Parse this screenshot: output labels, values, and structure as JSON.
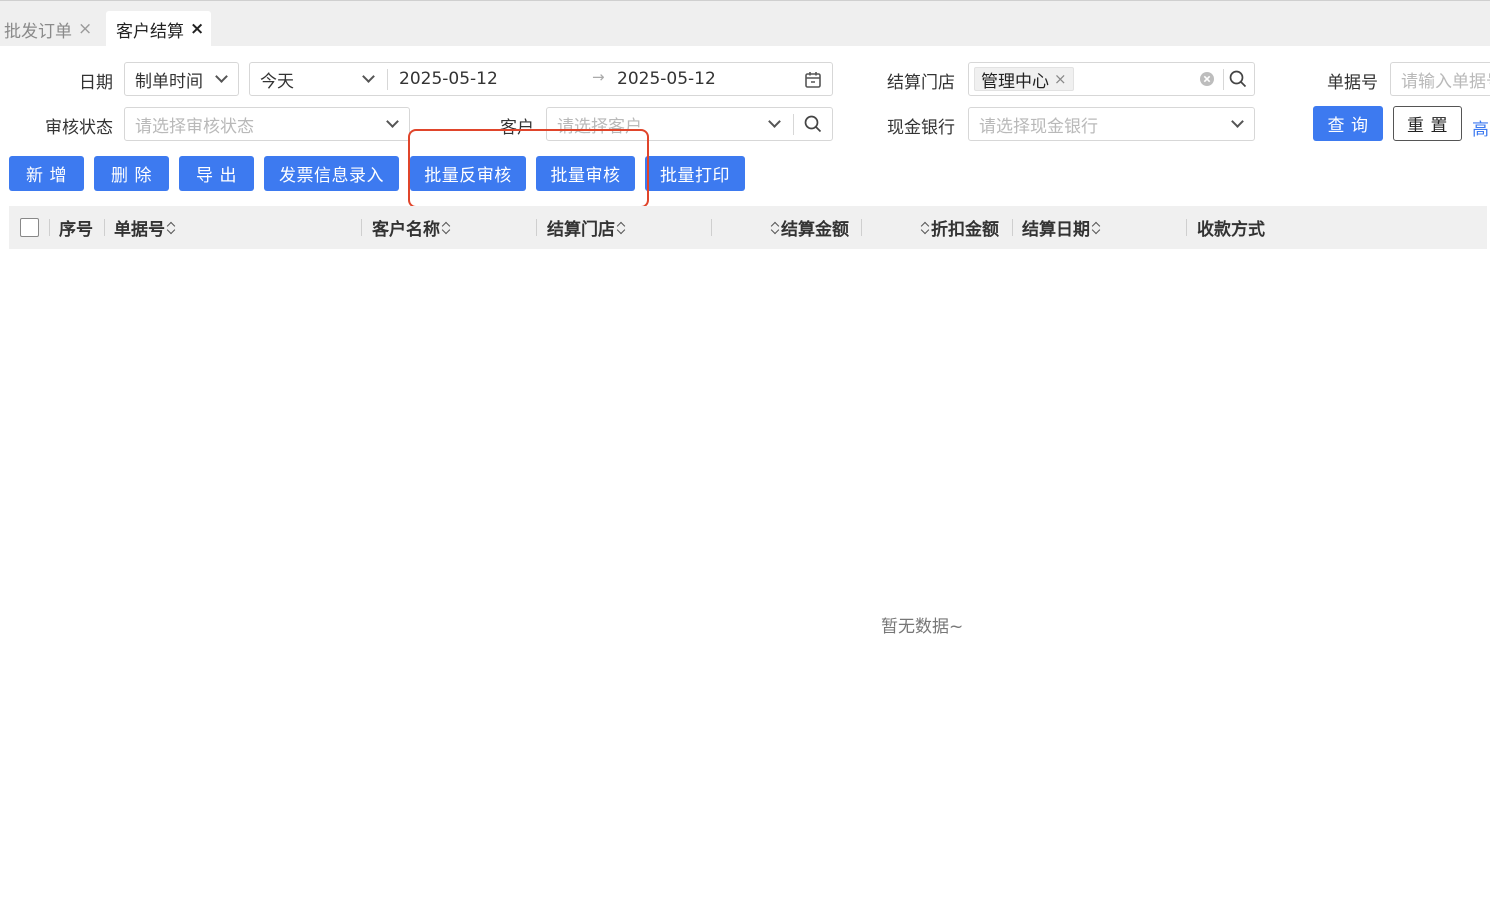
{
  "tabs": [
    {
      "label": "批发订单",
      "close": "×"
    },
    {
      "label": "客户结算",
      "close": "×"
    }
  ],
  "filters": {
    "date_label": "日期",
    "date_type": "制单时间",
    "date_range_preset": "今天",
    "date_start": "2025-05-12",
    "date_arrow": "→",
    "date_end": "2025-05-12",
    "store_label": "结算门店",
    "store_tag": "管理中心",
    "store_tag_close": "×",
    "doc_no_label": "单据号",
    "doc_no_placeholder": "请输入单据号",
    "audit_label": "审核状态",
    "audit_placeholder": "请选择审核状态",
    "customer_label": "客户",
    "customer_placeholder": "请选择客户",
    "bank_label": "现金银行",
    "bank_placeholder": "请选择现金银行"
  },
  "actions": {
    "query": "查 询",
    "reset": "重 置",
    "advanced": "高"
  },
  "toolbar": {
    "add": "新 增",
    "delete": "删 除",
    "export": "导 出",
    "invoice": "发票信息录入",
    "batch_unaudit": "批量反审核",
    "batch_audit": "批量审核",
    "batch_print": "批量打印"
  },
  "table": {
    "columns": [
      "序号",
      "单据号",
      "客户名称",
      "结算门店",
      "结算金额",
      "折扣金额",
      "结算日期",
      "收款方式"
    ],
    "rows": [],
    "empty_text": "暂无数据~"
  },
  "colors": {
    "primary": "#3d7af0",
    "highlight_border": "#e0452b"
  }
}
